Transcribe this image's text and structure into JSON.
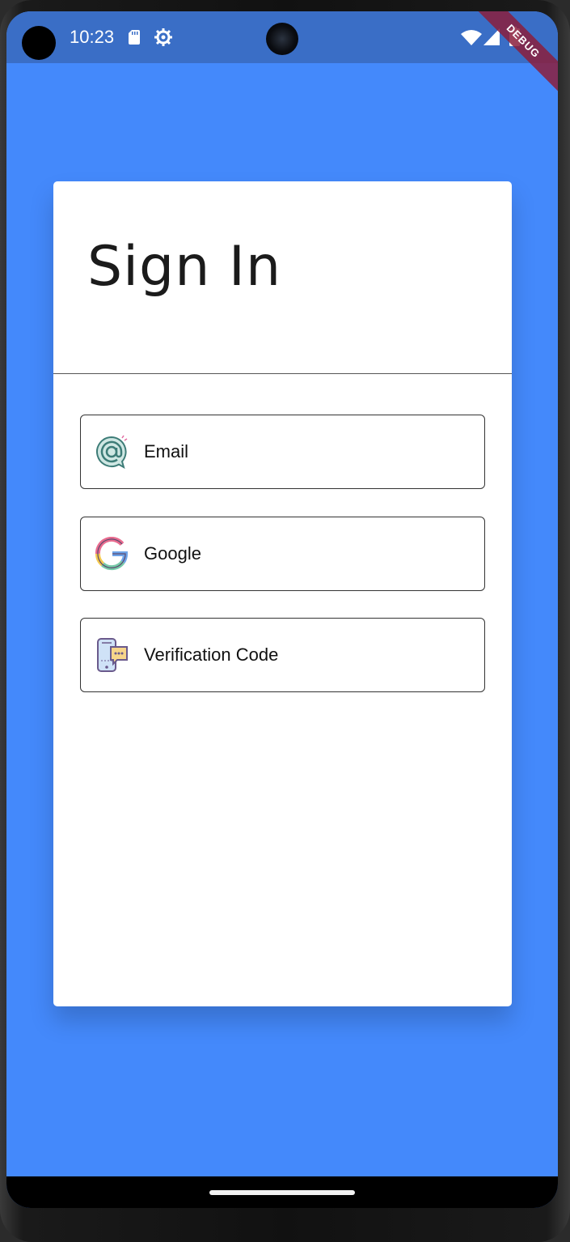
{
  "status_bar": {
    "time": "10:23",
    "color": "#3a6ec6",
    "icons": [
      "sd-card-icon",
      "gear-icon",
      "wifi-icon",
      "signal-icon",
      "battery-icon"
    ]
  },
  "debug_banner": "DEBUG",
  "background_color": "#4489fb",
  "card": {
    "title": "Sign In",
    "options": [
      {
        "label": "Email",
        "icon": "email-at-icon"
      },
      {
        "label": "Google",
        "icon": "google-icon"
      },
      {
        "label": "Verification Code",
        "icon": "phone-message-icon"
      }
    ]
  }
}
